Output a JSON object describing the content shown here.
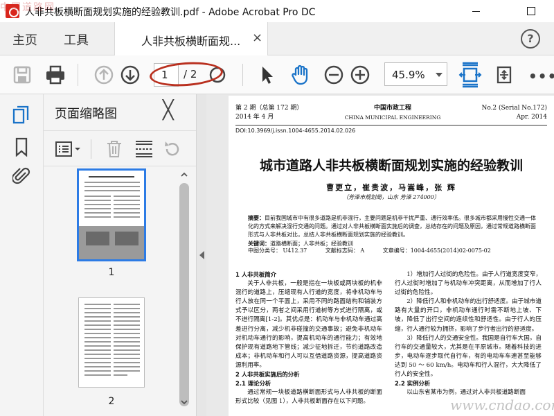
{
  "window": {
    "title": "人非共板横断面规划实施的经验教训.pdf - Adobe Acrobat Pro DC"
  },
  "tabs": {
    "home": "主页",
    "tools": "工具",
    "document": "人非共板横断面规...",
    "close": "×",
    "help": "?"
  },
  "toolbar": {
    "current_page": "1",
    "total_pages": "/ 2",
    "zoom": "45.9%",
    "more": "•••"
  },
  "panel": {
    "title": "页面缩略图",
    "close": "╳",
    "thumbs": [
      {
        "label": "1"
      },
      {
        "label": "2"
      }
    ]
  },
  "watermark": {
    "top": "中国道路网",
    "bottom": "www.cndao.com"
  },
  "doc": {
    "header_left_1": "第 2 期（总第 172 期）",
    "header_left_2": "2014 年 4 月",
    "header_center_1": "中国市政工程",
    "header_center_2": "CHINA MUNICIPAL ENGINEERING",
    "header_right_1": "No.2 (Serial No.172)",
    "header_right_2": "Apr. 2014",
    "doi": "DOI:10.3969/j.issn.1004-4655.2014.02.026",
    "title": "城市道路人非共板横断面规划实施的经验教训",
    "authors": "曹更立，崔贵波，马嵩峰，张 辉",
    "affiliation": "（芳泽市规划局，山东 芳泽 274000）",
    "abstract_label": "摘要：",
    "abstract_text": "目前我国城市中有很多道路是机非混行，主要问题是机非干扰严重、通行效率低。很多城市都采用慢性交通一体化的方式来解决混行交通的问题。通过对人非共板横断面实施后的调查，总结存在的问题及原因，通过常规道路横断面形式与人非共板对比，总结人非共板横断面规划实施的经验教训。",
    "keywords_label": "关键词：",
    "keywords": "道路横断面；人非共板；经验教训",
    "clc": "中图分类号： U412.37",
    "doc_code": "文献标志码： A",
    "article_no": "文章编号：1004-4655(2014)02-0075-02",
    "left_h1": "1 人非共板简介",
    "left_p1": "关于人非共板，一般是指在一块板或两块板的机非混行的道路上，压缩现有人行道的宽度，将非机动车与行人放在同一个平面上，采用不同的路面结构和铺装方式予以区分，两者之间采用行道树等方式进行隔离，或不进行隔离[1-2]。其优点是：机动车与非机动车通过高差进行分离，减少机非碰撞的交通事故；避免非机动车对机动车通行的影响，提高机动车的通行能力；有效地保护现有道路地下管线；减少征地拆迁，节约道路改造成本；非机动车和行人可以互借道路资源，提高道路资源利用率。",
    "left_h2": "2 人非共板实施后的分析",
    "left_h21": "2.1 理论分析",
    "left_p2": "通过常规一块板道路横断面形式与人非共板的断面形式比较（见图 1），人非共板断面存在以下问题。",
    "right_p1": "1）增加行人过街的危险性。由于人行道宽度变窄，行人过街时增加了与机动车冲突距离，从而增加了行人过街的危险性。",
    "right_p2": "2）降低行人和非机动车的出行舒适度。由于城市道路有大量的开口，非机动车通行时需不断地上坡、下坡，降低了出行空间的连续性和舒适性。由于行人的压缩，行人通行较为拥挤，影响了步行者出行的舒适度。",
    "right_p3": "3）降低行人的交通安全性。我国是自行车大国，自行车的交通量较大，尤其是在平原城市。随着科技的进步，电动车逐步取代自行车，有的电动车车速甚至能够达到 50 ～ 60 km/h。电动车和行人混行，大大降低了行人的安全性。",
    "right_h22": "2.2 实例分析",
    "right_p4": "以山东省某市为例，通过对人非共板道路断面"
  }
}
